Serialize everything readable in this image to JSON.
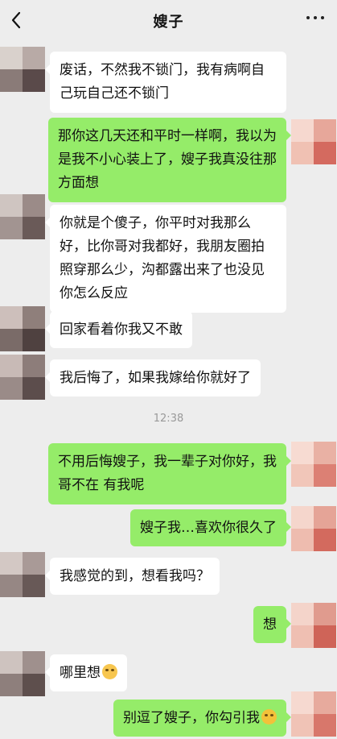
{
  "header": {
    "title": "嫂子"
  },
  "icons": {
    "back": "chevron-left-icon",
    "more": "more-dots-icon"
  },
  "messages": [
    {
      "text": "废话，不然我不锁门，我有病啊自己玩自己还不锁门"
    },
    {
      "text": "那你这几天还和平时一样啊，我以为是我不小心装上了，嫂子我真没往那方面想"
    },
    {
      "text": "你就是个傻子，你平时对我那么好，比你哥对我都好，我朋友圈拍照穿那么少，沟都露出来了也没见你怎么反应"
    },
    {
      "text": "回家看着你我又不敢"
    },
    {
      "text": "我后悔了，如果我嫁给你就好了"
    },
    {
      "text": "不用后悔嫂子，我一辈子对你好，我哥不在 有我呢"
    },
    {
      "text": "嫂子我…喜欢你很久了"
    },
    {
      "text": "我感觉的到，想看我吗？"
    },
    {
      "text": "想"
    },
    {
      "text": "哪里想"
    },
    {
      "text": "别逗了嫂子，你勾引我"
    }
  ],
  "timestamp": "12:38",
  "colors": {
    "background": "#ededed",
    "sent_bubble": "#95ec69",
    "received_bubble": "#ffffff"
  }
}
